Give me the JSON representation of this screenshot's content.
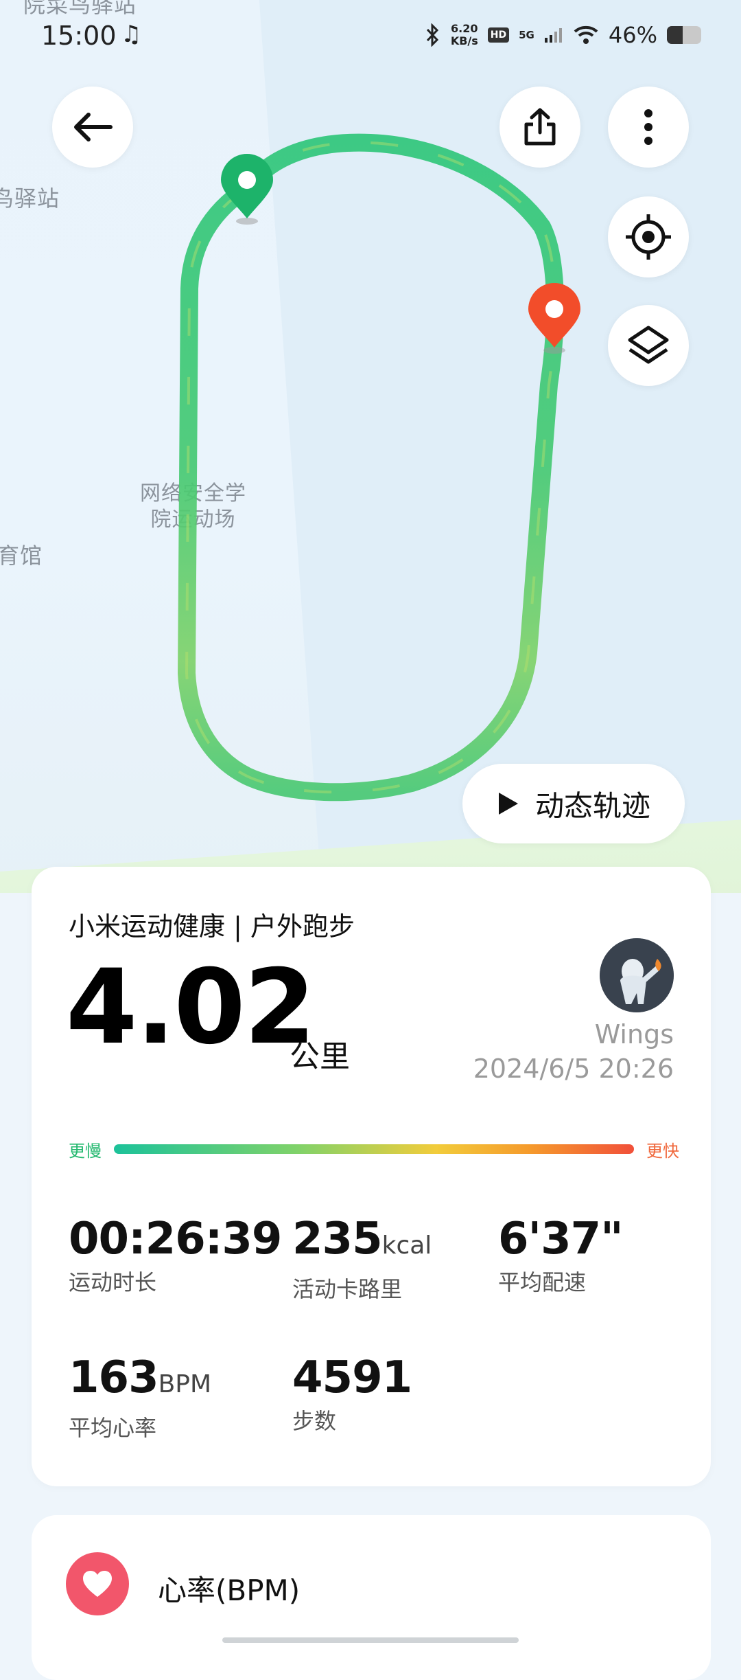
{
  "status_bar": {
    "time": "15:00",
    "music_icon": "music-note-icon",
    "net_speed_value": "6.20",
    "net_speed_unit": "KB/s",
    "hd_badge": "HD",
    "network": "5G",
    "battery_percent": "46%",
    "battery_level": 0.46
  },
  "map": {
    "labels": {
      "top_left": "院菜鸟驿站",
      "left_mid": "鸟驿站",
      "venue_line1": "网络安全学",
      "venue_line2": "院运动场",
      "left_lower": "育馆"
    },
    "buttons": {
      "back": "arrow-left-icon",
      "share": "share-icon",
      "more": "more-vertical-icon",
      "locate": "locate-target-icon",
      "layers": "layers-icon"
    },
    "dynamic_track_label": "动态轨迹",
    "start_marker_color": "#1db36a",
    "end_marker_color": "#f24d2a"
  },
  "summary": {
    "header": "小米运动健康 | 户外跑步",
    "distance": "4.02",
    "distance_unit": "公里",
    "username": "Wings",
    "datetime": "2024/6/5 20:26",
    "pace_slow_label": "更慢",
    "pace_fast_label": "更快",
    "stats": [
      {
        "value": "00:26:39",
        "unit": "",
        "label": "运动时长"
      },
      {
        "value": "235",
        "unit": "kcal",
        "label": "活动卡路里"
      },
      {
        "value": "6'37\"",
        "unit": "",
        "label": "平均配速"
      },
      {
        "value": "163",
        "unit": "BPM",
        "label": "平均心率"
      },
      {
        "value": "4591",
        "unit": "",
        "label": "步数"
      }
    ]
  },
  "heart_card": {
    "title": "心率(BPM)",
    "icon": "heart-icon"
  },
  "colors": {
    "track_green": "#3cc878",
    "pace_fast": "#f0683c",
    "pace_slow": "#22b86e",
    "heart": "#f2566b"
  }
}
